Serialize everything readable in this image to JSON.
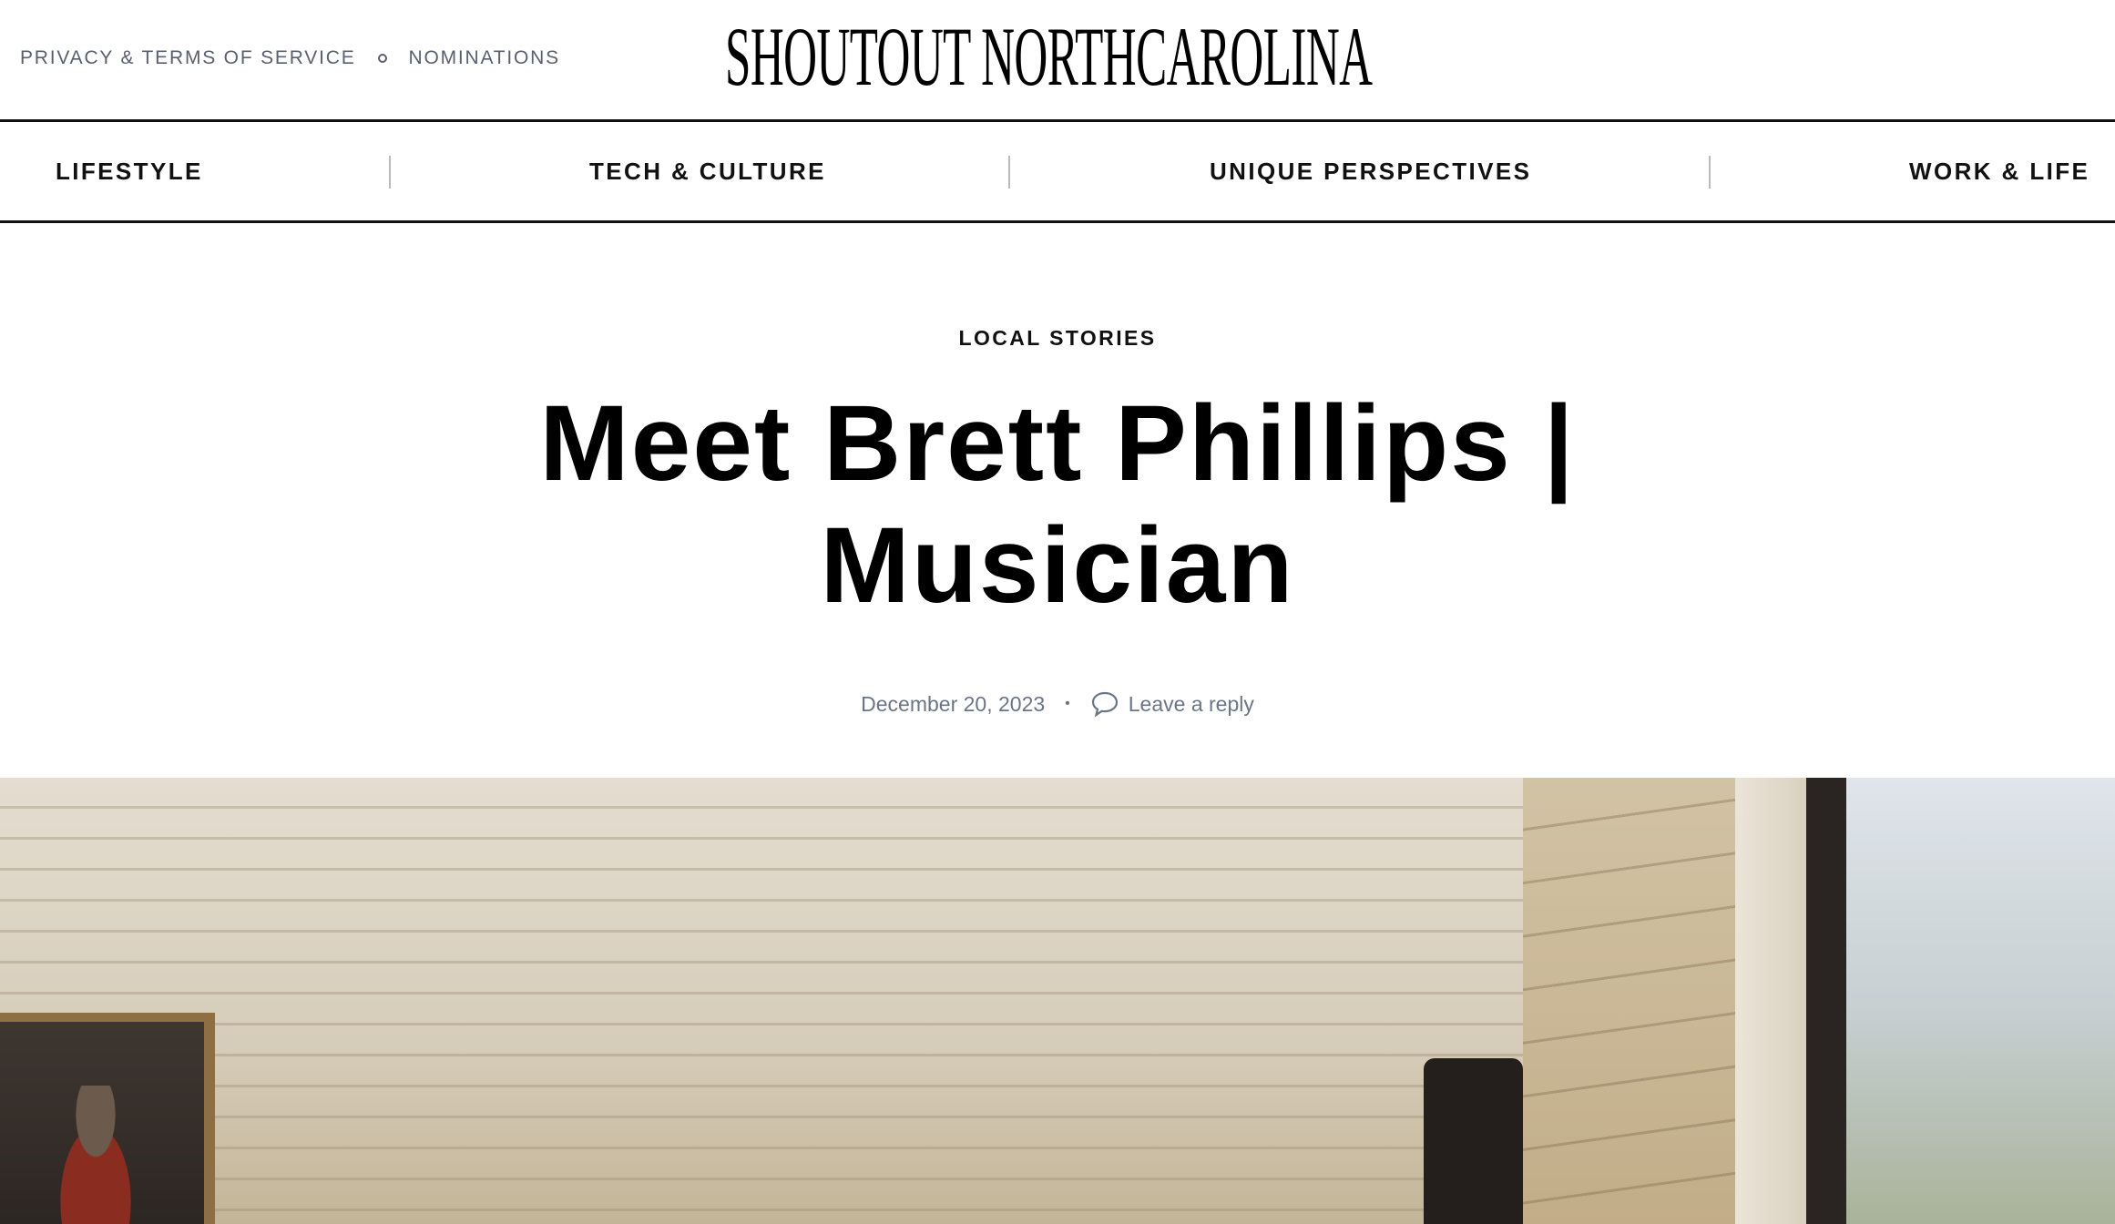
{
  "top_links": {
    "privacy": "PRIVACY & TERMS OF SERVICE",
    "nominations": "NOMINATIONS"
  },
  "logo": "SHOUTOUT NORTHCAROLINA",
  "nav": [
    "LIFESTYLE",
    "TECH & CULTURE",
    "UNIQUE PERSPECTIVES",
    "WORK & LIFE"
  ],
  "article": {
    "category": "LOCAL STORIES",
    "title_line1": "Meet Brett Phillips |",
    "title_line2": "Musician",
    "date": "December 20, 2023",
    "reply": "Leave a reply"
  },
  "colors": {
    "meta": "#6b7588",
    "text": "#111111"
  }
}
